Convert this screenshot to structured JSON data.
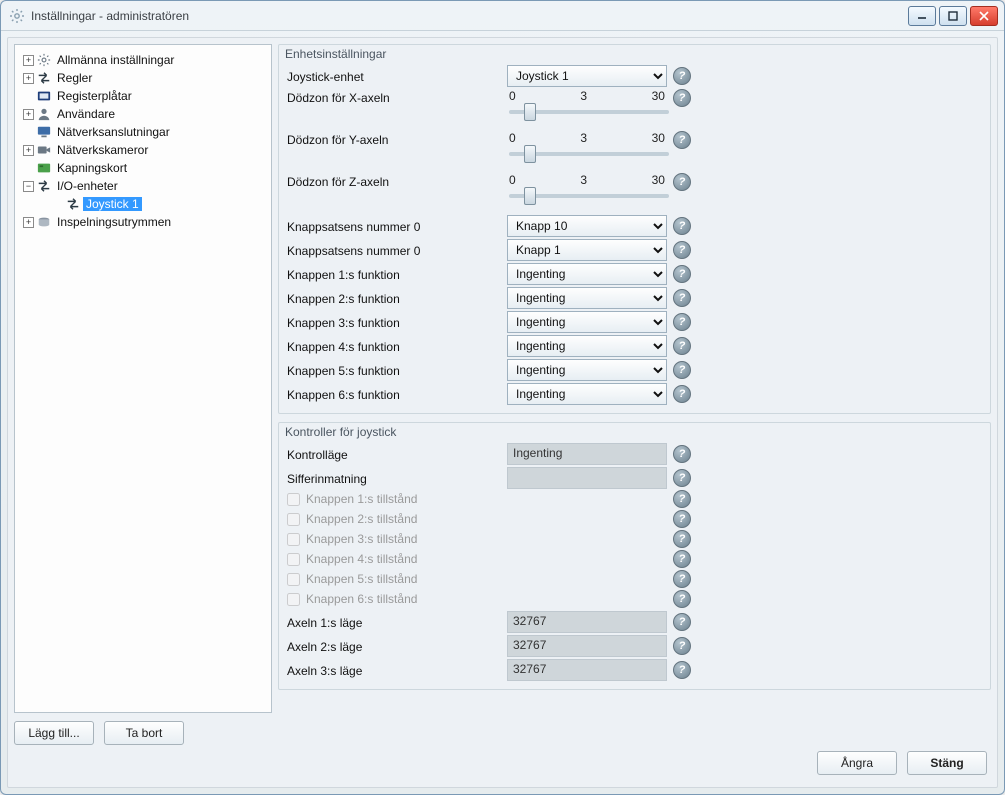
{
  "window": {
    "title": "Inställningar - administratören"
  },
  "tree": {
    "items": [
      {
        "label": "Allmänna inställningar",
        "expandable": true,
        "icon": "gear"
      },
      {
        "label": "Regler",
        "expandable": true,
        "icon": "arrows"
      },
      {
        "label": "Registerplåtar",
        "expandable": false,
        "icon": "plate"
      },
      {
        "label": "Användare",
        "expandable": true,
        "icon": "user"
      },
      {
        "label": "Nätverksanslutningar",
        "expandable": false,
        "icon": "monitor"
      },
      {
        "label": "Nätverkskameror",
        "expandable": true,
        "icon": "camera"
      },
      {
        "label": "Kapningskort",
        "expandable": false,
        "icon": "card"
      },
      {
        "label": "I/O-enheter",
        "expandable": true,
        "expanded": true,
        "icon": "arrows",
        "children": [
          {
            "label": "Joystick 1",
            "icon": "arrows",
            "selected": true
          }
        ]
      },
      {
        "label": "Inspelningsutrymmen",
        "expandable": true,
        "icon": "disk"
      }
    ]
  },
  "tree_buttons": {
    "add": "Lägg till...",
    "remove": "Ta bort"
  },
  "group1": {
    "title": "Enhetsinställningar",
    "joystick_label": "Joystick-enhet",
    "joystick_value": "Joystick 1",
    "deadzones": [
      {
        "label": "Dödzon för X-axeln",
        "min": "0",
        "mid": "3",
        "max": "30"
      },
      {
        "label": "Dödzon för Y-axeln",
        "min": "0",
        "mid": "3",
        "max": "30"
      },
      {
        "label": "Dödzon för Z-axeln",
        "min": "0",
        "mid": "3",
        "max": "30"
      }
    ],
    "numbers": [
      {
        "label": "Knappsatsens nummer 0",
        "value": "Knapp 10"
      },
      {
        "label": "Knappsatsens nummer 0",
        "value": "Knapp 1"
      }
    ],
    "functions": [
      {
        "label": "Knappen 1:s funktion",
        "value": "Ingenting"
      },
      {
        "label": "Knappen 2:s funktion",
        "value": "Ingenting"
      },
      {
        "label": "Knappen 3:s funktion",
        "value": "Ingenting"
      },
      {
        "label": "Knappen 4:s funktion",
        "value": "Ingenting"
      },
      {
        "label": "Knappen 5:s funktion",
        "value": "Ingenting"
      },
      {
        "label": "Knappen 6:s funktion",
        "value": "Ingenting"
      }
    ]
  },
  "group2": {
    "title": "Kontroller för joystick",
    "mode_label": "Kontrolläge",
    "mode_value": "Ingenting",
    "numin_label": "Sifferinmatning",
    "numin_value": "",
    "states": [
      {
        "label": "Knappen 1:s tillstånd"
      },
      {
        "label": "Knappen 2:s tillstånd"
      },
      {
        "label": "Knappen 3:s tillstånd"
      },
      {
        "label": "Knappen 4:s tillstånd"
      },
      {
        "label": "Knappen 5:s tillstånd"
      },
      {
        "label": "Knappen 6:s tillstånd"
      }
    ],
    "axes": [
      {
        "label": "Axeln 1:s läge",
        "value": "32767"
      },
      {
        "label": "Axeln 2:s läge",
        "value": "32767"
      },
      {
        "label": "Axeln 3:s läge",
        "value": "32767"
      }
    ]
  },
  "footer": {
    "undo": "Ångra",
    "close": "Stäng"
  }
}
